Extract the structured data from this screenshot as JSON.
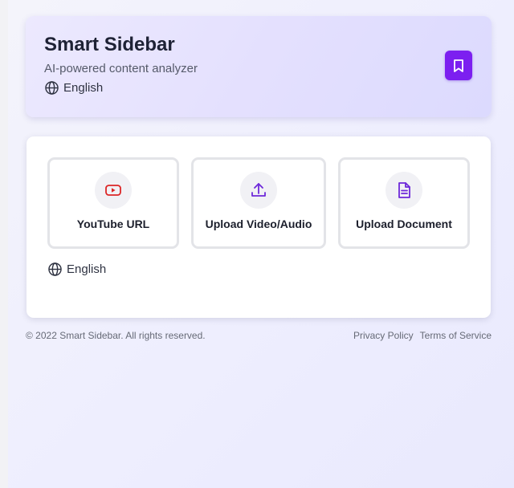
{
  "header": {
    "title": "Smart Sidebar",
    "subtitle": "AI-powered content analyzer",
    "language": "English",
    "bookmark_icon": "bookmark-icon",
    "accent_color": "#7c1ff0"
  },
  "options": [
    {
      "label": "YouTube URL",
      "icon": "youtube-icon",
      "color": "#dc2626"
    },
    {
      "label": "Upload Video/Audio",
      "icon": "upload-icon",
      "color": "#6d28d9"
    },
    {
      "label": "Upload Document",
      "icon": "document-icon",
      "color": "#6d28d9"
    }
  ],
  "main": {
    "language": "English"
  },
  "footer": {
    "copyright": "© 2022 Smart Sidebar. All rights reserved.",
    "links": [
      "Privacy Policy",
      "Terms of Service"
    ]
  }
}
